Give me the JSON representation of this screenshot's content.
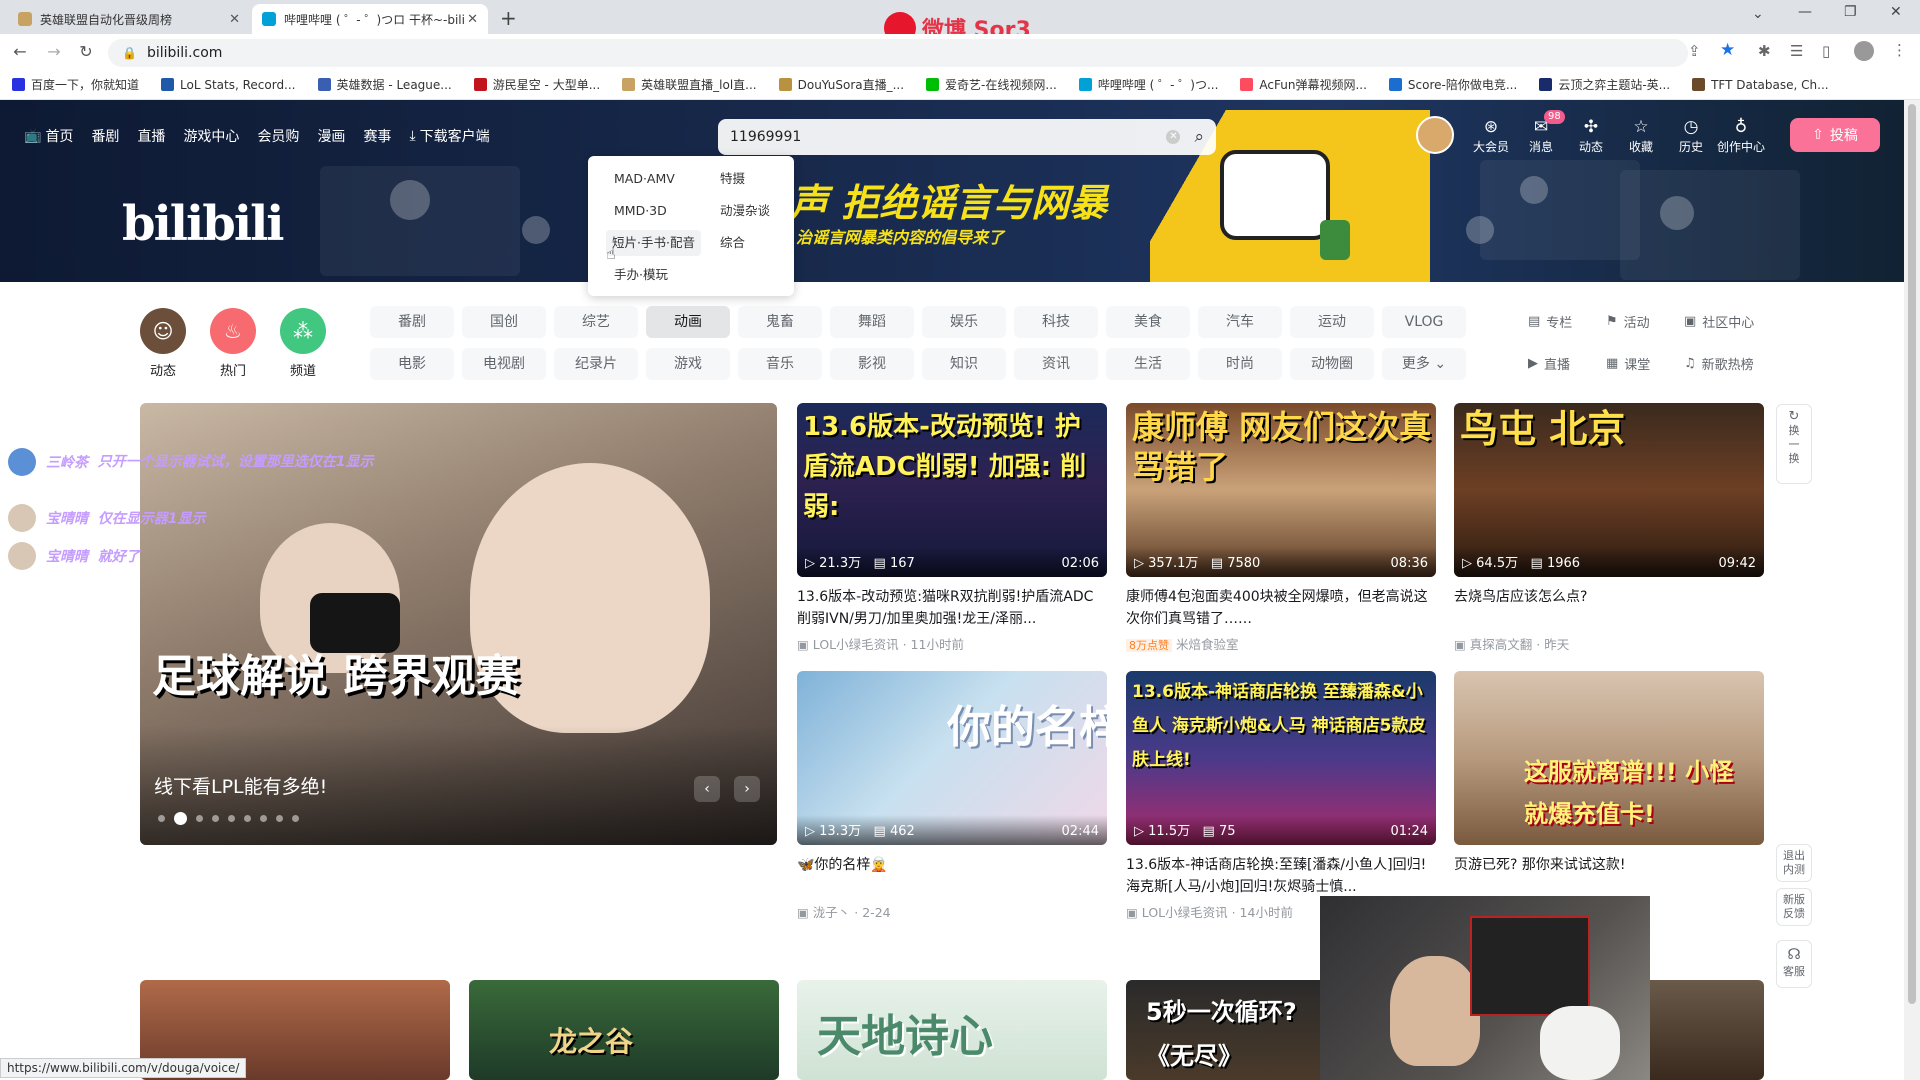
{
  "browser": {
    "tabs": [
      {
        "title": "英雄联盟自动化晋级周榜",
        "active": false
      },
      {
        "title": "哔哩哔哩 ( ゜- ゜)つロ 干杯~-bili",
        "active": true
      }
    ],
    "new_tab": "+",
    "url": "bilibili.com",
    "bookmarks": [
      "百度一下，你就知道",
      "LoL Stats, Record...",
      "英雄数据 - League...",
      "游民星空 - 大型单...",
      "英雄联盟直播_lol直...",
      "DouYuSora直播_...",
      "爱奇艺-在线视频网...",
      "哔哩哔哩 ( ゜- ゜)つ...",
      "AcFun弹幕视频网...",
      "Score-陪你做电竞...",
      "云顶之弈主题站-英...",
      "TFT Database, Ch..."
    ],
    "status_url": "https://www.bilibili.com/v/douga/voice/",
    "weibo_watermark": "微博 Sor3"
  },
  "header": {
    "nav": [
      "首页",
      "番剧",
      "直播",
      "游戏中心",
      "会员购",
      "漫画",
      "赛事",
      "下载客户端"
    ],
    "search_value": "11969991",
    "right": [
      {
        "label": "大会员",
        "icon": "vip-icon"
      },
      {
        "label": "消息",
        "icon": "message-icon",
        "badge": "98"
      },
      {
        "label": "动态",
        "icon": "dynamic-icon"
      },
      {
        "label": "收藏",
        "icon": "star-icon"
      },
      {
        "label": "历史",
        "icon": "clock-icon"
      },
      {
        "label": "创作中心",
        "icon": "lightbulb-icon"
      }
    ],
    "upload": "投稿",
    "logo": "bilibili",
    "banner_slogan": "声 拒绝谣言与网暴",
    "banner_sub": "治谣言网暴类内容的倡导来了"
  },
  "dropdown": {
    "items": [
      "MAD·AMV",
      "特摄",
      "MMD·3D",
      "动漫杂谈",
      "短片·手书·配音",
      "综合",
      "手办·模玩"
    ],
    "hovered": "短片·手书·配音"
  },
  "channels": [
    {
      "label": "动态",
      "color": "#6b4f3a"
    },
    {
      "label": "热门",
      "color": "#f76a6f"
    },
    {
      "label": "频道",
      "color": "#41c780"
    }
  ],
  "categories": {
    "row1": [
      "番剧",
      "国创",
      "综艺",
      "动画",
      "鬼畜",
      "舞蹈",
      "娱乐",
      "科技",
      "美食",
      "汽车",
      "运动",
      "VLOG"
    ],
    "row2": [
      "电影",
      "电视剧",
      "纪录片",
      "游戏",
      "音乐",
      "影视",
      "知识",
      "资讯",
      "生活",
      "时尚",
      "动物圈",
      "更多"
    ],
    "selected": "动画"
  },
  "side_links": {
    "row1": [
      "专栏",
      "活动",
      "社区中心"
    ],
    "row2": [
      "直播",
      "课堂",
      "新歌热榜"
    ]
  },
  "carousel": {
    "caption": "线下看LPL能有多绝!",
    "big_text": "足球解说 跨界观赛",
    "dots": 9,
    "active_dot": 1
  },
  "danmaku": [
    {
      "user": "三岭茶",
      "text": "只开一个显示器试试，设置那里选仅在1显示"
    },
    {
      "user": "宝晴晴",
      "text": "仅在显示器1显示"
    },
    {
      "user": "宝晴晴",
      "text": "就好了"
    }
  ],
  "videos": [
    {
      "overlay": "13.6版本-改动预览! 护盾流ADC削弱! 加强: 削弱:",
      "views": "21.3万",
      "danmaku": "167",
      "duration": "02:06",
      "title": "13.6版本-改动预览:猫咪R双抗削弱!护盾流ADC削弱IVN/男刀/加里奥加强!龙王/泽丽...",
      "up": "LOL小绿毛资讯",
      "time": "11小时前",
      "tag": ""
    },
    {
      "overlay": "康师傅 网友们这次真骂错了",
      "views": "357.1万",
      "danmaku": "7580",
      "duration": "08:36",
      "title": "康师傅4包泡面卖400块被全网爆喷，但老高说这次你们真骂错了……",
      "up": "米焙食验室",
      "time": "",
      "tag": "8万点赞"
    },
    {
      "overlay": "鸟屯 北京",
      "views": "64.5万",
      "danmaku": "1966",
      "duration": "09:42",
      "title": "去烧鸟店应该怎么点?",
      "up": "真探高文翻",
      "time": "昨天",
      "tag": ""
    },
    {
      "overlay": "你的名梓",
      "views": "13.3万",
      "danmaku": "462",
      "duration": "02:44",
      "title": "🦋你的名梓🧝",
      "up": "泷子丶",
      "time": "2-24",
      "tag": ""
    },
    {
      "overlay": "13.6版本-神话商店轮换 至臻潘森&小鱼人 海克斯小炮&人马 神话商店5款皮肤上线!",
      "views": "11.5万",
      "danmaku": "75",
      "duration": "01:24",
      "title": "13.6版本-神话商店轮换:至臻[潘森/小鱼人]回归!海克斯[人马/小炮]回归!灰烬骑士慎...",
      "up": "LOL小绿毛资讯",
      "time": "14小时前",
      "tag": ""
    },
    {
      "overlay": "这服就离谱!!! 小怪就爆充值卡!",
      "views": "",
      "danmaku": "",
      "duration": "",
      "title": "页游已死? 那你来试试这款!",
      "up": "",
      "time": "",
      "tag": ""
    }
  ],
  "bottom_thumbs": [
    "",
    "龙之谷",
    "天地诗心",
    "5秒一次循环? 《无尽》"
  ],
  "floating": {
    "refresh": "换一换",
    "exit": "退出内测",
    "feedback": "新版反馈",
    "service": "客服"
  }
}
